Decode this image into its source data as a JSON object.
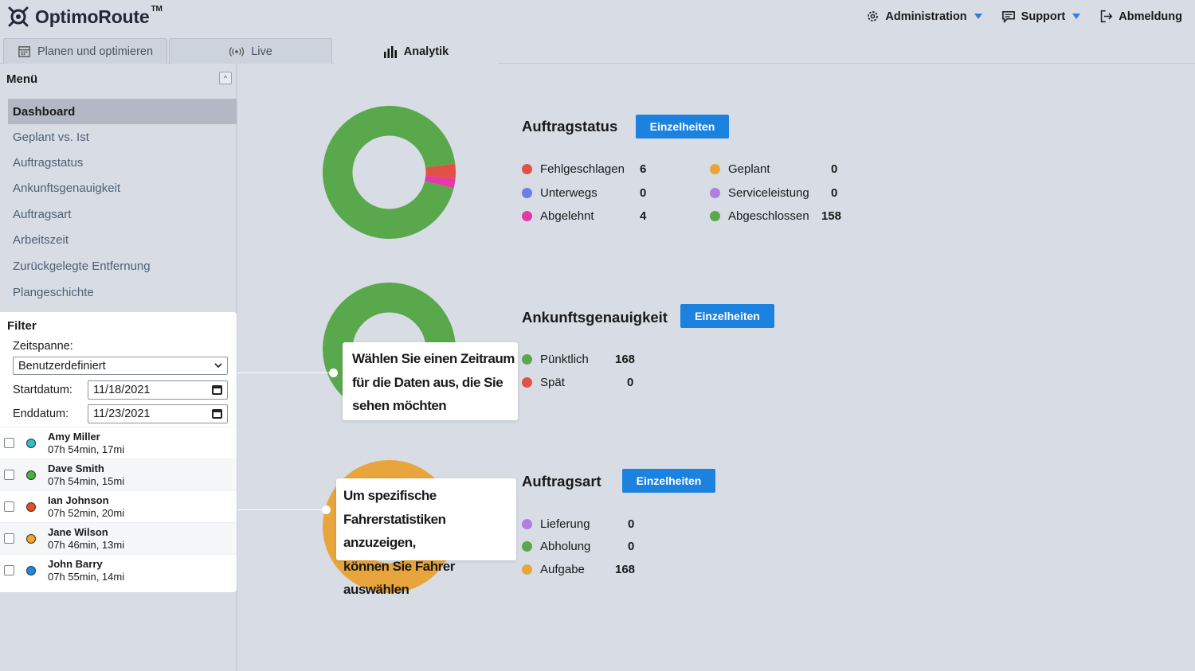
{
  "app": {
    "name": "OptimoRoute",
    "tm": "TM"
  },
  "topnav": {
    "administration": "Administration",
    "support": "Support",
    "logout": "Abmeldung"
  },
  "tabs": [
    {
      "label": "Planen und optimieren",
      "icon": "calendar-icon"
    },
    {
      "label": "Live",
      "icon": "broadcast-icon"
    },
    {
      "label": "Analytik",
      "icon": "bar-chart-icon",
      "active": true
    }
  ],
  "sidebar": {
    "menu_title": "Menü",
    "collapse_symbol": "^",
    "items": [
      {
        "label": "Dashboard",
        "active": true
      },
      {
        "label": "Geplant vs. Ist"
      },
      {
        "label": "Auftragstatus"
      },
      {
        "label": "Ankunftsgenauigkeit"
      },
      {
        "label": "Auftragsart"
      },
      {
        "label": "Arbeitszeit"
      },
      {
        "label": "Zurückgelegte Entfernung"
      },
      {
        "label": "Plangeschichte"
      }
    ]
  },
  "filter": {
    "title": "Filter",
    "period_label": "Zeitspanne:",
    "period_value": "Benutzerdefiniert",
    "start_label": "Startdatum:",
    "start_value": "11/18/2021",
    "end_label": "Enddatum:",
    "end_value": "11/23/2021",
    "drivers": [
      {
        "name": "Amy Miller",
        "stats": "07h 54min, 17mi",
        "color": "#2bbfc9"
      },
      {
        "name": "Dave Smith",
        "stats": "07h 54min, 15mi",
        "color": "#45b536"
      },
      {
        "name": "Ian Johnson",
        "stats": "07h 52min, 20mi",
        "color": "#ef4b22"
      },
      {
        "name": "Jane Wilson",
        "stats": "07h 46min, 13mi",
        "color": "#f6a623"
      },
      {
        "name": "John Barry",
        "stats": "07h 55min, 14mi",
        "color": "#1a8ae8"
      }
    ]
  },
  "sections": {
    "status": {
      "title": "Auftragstatus",
      "button": "Einzelheiten",
      "legend": [
        {
          "label": "Fehlgeschlagen",
          "value": "6",
          "color": "#e15244"
        },
        {
          "label": "Unterwegs",
          "value": "0",
          "color": "#6b7fe0"
        },
        {
          "label": "Abgelehnt",
          "value": "4",
          "color": "#e43aa6"
        },
        {
          "label": "Geplant",
          "value": "0",
          "color": "#e8a53b"
        },
        {
          "label": "Serviceleistung",
          "value": "0",
          "color": "#b27fe0"
        },
        {
          "label": "Abgeschlossen",
          "value": "158",
          "color": "#5aa84c"
        }
      ]
    },
    "accuracy": {
      "title": "Ankunftsgenauigkeit",
      "button": "Einzelheiten",
      "legend": [
        {
          "label": "Pünktlich",
          "value": "168",
          "color": "#5aa84c"
        },
        {
          "label": "Spät",
          "value": "0",
          "color": "#e15244"
        }
      ]
    },
    "type": {
      "title": "Auftragsart",
      "button": "Einzelheiten",
      "legend": [
        {
          "label": "Lieferung",
          "value": "0",
          "color": "#b27fe0"
        },
        {
          "label": "Abholung",
          "value": "0",
          "color": "#5aa84c"
        },
        {
          "label": "Aufgabe",
          "value": "168",
          "color": "#e8a53b"
        }
      ]
    }
  },
  "callouts": {
    "timeframe": [
      "Wählen Sie einen Zeitraum",
      "für die Daten aus, die Sie",
      "sehen möchten"
    ],
    "drivers": [
      "Um spezifische",
      "Fahrerstatistiken anzuzeigen,",
      "können Sie Fahrer auswählen"
    ]
  },
  "chart_data": [
    {
      "type": "pie",
      "categories": [
        "Fehlgeschlagen",
        "Unterwegs",
        "Abgelehnt",
        "Geplant",
        "Serviceleistung",
        "Abgeschlossen"
      ],
      "values": [
        6,
        0,
        4,
        0,
        0,
        158
      ],
      "colors": [
        "#e15244",
        "#6b7fe0",
        "#e43aa6",
        "#e8a53b",
        "#b27fe0",
        "#5aa84c"
      ]
    },
    {
      "type": "pie",
      "categories": [
        "Pünktlich",
        "Spät"
      ],
      "values": [
        168,
        0
      ],
      "colors": [
        "#5aa84c",
        "#e15244"
      ]
    },
    {
      "type": "pie",
      "categories": [
        "Lieferung",
        "Abholung",
        "Aufgabe"
      ],
      "values": [
        0,
        0,
        168
      ],
      "colors": [
        "#b27fe0",
        "#5aa84c",
        "#e8a53b"
      ]
    }
  ]
}
